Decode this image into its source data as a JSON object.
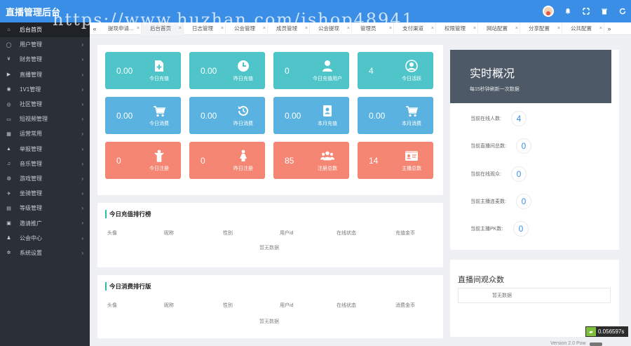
{
  "header": {
    "logo": "直播管理后台",
    "watermark": "https://www.huzhan.com/ishop48941"
  },
  "sidebar": {
    "items": [
      {
        "label": "后台首页",
        "icon": "home-icon",
        "glyph": "⌂",
        "active": true,
        "has_arrow": false
      },
      {
        "label": "用户管理",
        "icon": "user-icon",
        "glyph": "◯",
        "active": false,
        "has_arrow": true
      },
      {
        "label": "财务管理",
        "icon": "yen-icon",
        "glyph": "¥",
        "active": false,
        "has_arrow": true
      },
      {
        "label": "直播管理",
        "icon": "video-icon",
        "glyph": "▶",
        "active": false,
        "has_arrow": true
      },
      {
        "label": "1V1管理",
        "icon": "eye-icon",
        "glyph": "◉",
        "active": false,
        "has_arrow": true
      },
      {
        "label": "社区管理",
        "icon": "community-icon",
        "glyph": "◎",
        "active": false,
        "has_arrow": true
      },
      {
        "label": "短视频管理",
        "icon": "monitor-icon",
        "glyph": "▭",
        "active": false,
        "has_arrow": true
      },
      {
        "label": "运营常用",
        "icon": "calendar-icon",
        "glyph": "▦",
        "active": false,
        "has_arrow": true
      },
      {
        "label": "举报管理",
        "icon": "warning-icon",
        "glyph": "▲",
        "active": false,
        "has_arrow": true
      },
      {
        "label": "音乐管理",
        "icon": "music-icon",
        "glyph": "♫",
        "active": false,
        "has_arrow": true
      },
      {
        "label": "游戏管理",
        "icon": "gamepad-icon",
        "glyph": "◍",
        "active": false,
        "has_arrow": true
      },
      {
        "label": "坐骑管理",
        "icon": "plane-icon",
        "glyph": "✈",
        "active": false,
        "has_arrow": true
      },
      {
        "label": "等级管理",
        "icon": "level-icon",
        "glyph": "▤",
        "active": false,
        "has_arrow": true
      },
      {
        "label": "邀请推广",
        "icon": "invite-icon",
        "glyph": "▣",
        "active": false,
        "has_arrow": true
      },
      {
        "label": "公会中心",
        "icon": "users-icon",
        "glyph": "♟",
        "active": false,
        "has_arrow": true
      },
      {
        "label": "系统设置",
        "icon": "gears-icon",
        "glyph": "✲",
        "active": false,
        "has_arrow": true
      }
    ]
  },
  "tabs": {
    "items": [
      {
        "label": "提现申请...",
        "active": false
      },
      {
        "label": "后台首页",
        "active": true
      },
      {
        "label": "日志管理",
        "active": false
      },
      {
        "label": "公会管理",
        "active": false
      },
      {
        "label": "成员管理",
        "active": false
      },
      {
        "label": "公会提现",
        "active": false
      },
      {
        "label": "管理员",
        "active": false
      },
      {
        "label": "支付渠道",
        "active": false
      },
      {
        "label": "权限管理",
        "active": false
      },
      {
        "label": "网站配置",
        "active": false
      },
      {
        "label": "分享配置",
        "active": false
      },
      {
        "label": "公共配置",
        "active": false
      }
    ],
    "prev": "«",
    "next": "»",
    "close": "×"
  },
  "tiles": [
    {
      "value": "0.00",
      "label": "今日充值",
      "color": "teal",
      "icon": "add-file-icon"
    },
    {
      "value": "0.00",
      "label": "昨日充值",
      "color": "teal",
      "icon": "clock-icon"
    },
    {
      "value": "0",
      "label": "今日充值用户",
      "color": "teal",
      "icon": "person-icon"
    },
    {
      "value": "4",
      "label": "今日活跃",
      "color": "teal",
      "icon": "user-circle-icon"
    },
    {
      "value": "0.00",
      "label": "今日消费",
      "color": "blue",
      "icon": "cart-icon"
    },
    {
      "value": "0.00",
      "label": "昨日消费",
      "color": "blue",
      "icon": "history-icon"
    },
    {
      "value": "0.00",
      "label": "本月充值",
      "color": "blue",
      "icon": "address-book-icon"
    },
    {
      "value": "0.00",
      "label": "本月消费",
      "color": "blue",
      "icon": "cart-icon"
    },
    {
      "value": "0",
      "label": "今日注册",
      "color": "salmon",
      "icon": "child-icon"
    },
    {
      "value": "0",
      "label": "昨日注册",
      "color": "salmon",
      "icon": "female-icon"
    },
    {
      "value": "85",
      "label": "注册总数",
      "color": "salmon",
      "icon": "group-icon"
    },
    {
      "value": "14",
      "label": "主播总数",
      "color": "salmon",
      "icon": "id-card-icon"
    }
  ],
  "recharge_rank": {
    "title": "今日充值排行榜",
    "columns": [
      "头像",
      "昵称",
      "性别",
      "用户id",
      "在线状态",
      "充值金币"
    ],
    "empty": "暂无数据"
  },
  "consume_rank": {
    "title": "今日消费排行版",
    "columns": [
      "头像",
      "昵称",
      "性别",
      "用户id",
      "在线状态",
      "消费金币"
    ],
    "empty": "暂无数据"
  },
  "realtime": {
    "title": "实时概况",
    "subtitle": "每15秒钟刷新一次数据",
    "stats": [
      {
        "label": "当前在线人数:",
        "value": "4"
      },
      {
        "label": "当前直播间总数:",
        "value": "0"
      },
      {
        "label": "当前在线观众:",
        "value": "0"
      },
      {
        "label": "当前主播连麦数:",
        "value": "0"
      },
      {
        "label": "当前主播PK数:",
        "value": "0"
      }
    ]
  },
  "viewers": {
    "title": "直播间观众数",
    "empty": "暂无数据"
  },
  "footer": {
    "timer": "0.056597s",
    "version": "Version 2.0 Pow"
  }
}
